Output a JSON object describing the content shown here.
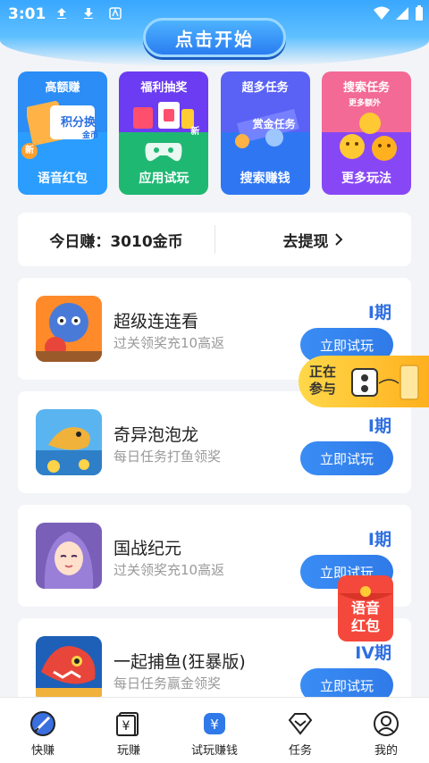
{
  "status_bar": {
    "time": "3:01"
  },
  "start_button": "点击开始",
  "tiles": [
    {
      "top": "高额赚",
      "mid": "积分换",
      "mid_sub": "金币",
      "corner": "新",
      "bottom": "语音红包"
    },
    {
      "top": "福利抽奖",
      "corner": "新",
      "bottom": "应用试玩"
    },
    {
      "top": "超多任务",
      "mid": "赏金任务",
      "bottom": "搜索赚钱"
    },
    {
      "top": "搜索任务",
      "top_sub": "更多额外",
      "bottom": "更多玩法"
    }
  ],
  "earnings": {
    "today": "今日赚：3010金币",
    "withdraw": "去提现"
  },
  "games": [
    {
      "name": "超级连连看",
      "desc": "过关领奖充10高返",
      "period": "I期",
      "button": "立即试玩"
    },
    {
      "name": "奇异泡泡龙",
      "desc": "每日任务打鱼领奖",
      "period": "I期",
      "button": "立即试玩"
    },
    {
      "name": "国战纪元",
      "desc": "过关领奖充10高返",
      "period": "I期",
      "button": "立即试玩"
    },
    {
      "name": "一起捕鱼(狂暴版)",
      "desc": "每日任务赢金领奖",
      "period": "IV期",
      "button": "立即试玩"
    }
  ],
  "floating": {
    "join_line1": "正在",
    "join_line2": "参与",
    "redpack_line1": "语音",
    "redpack_line2": "红包"
  },
  "tabs": [
    {
      "label": "快赚",
      "icon": "rocket-icon"
    },
    {
      "label": "玩赚",
      "icon": "yen-card-icon"
    },
    {
      "label": "试玩赚钱",
      "icon": "yen-bag-icon"
    },
    {
      "label": "任务",
      "icon": "diamond-icon"
    },
    {
      "label": "我的",
      "icon": "user-icon"
    }
  ],
  "colors": {
    "accent": "#2f7ae8",
    "period": "#2f6fe0"
  }
}
